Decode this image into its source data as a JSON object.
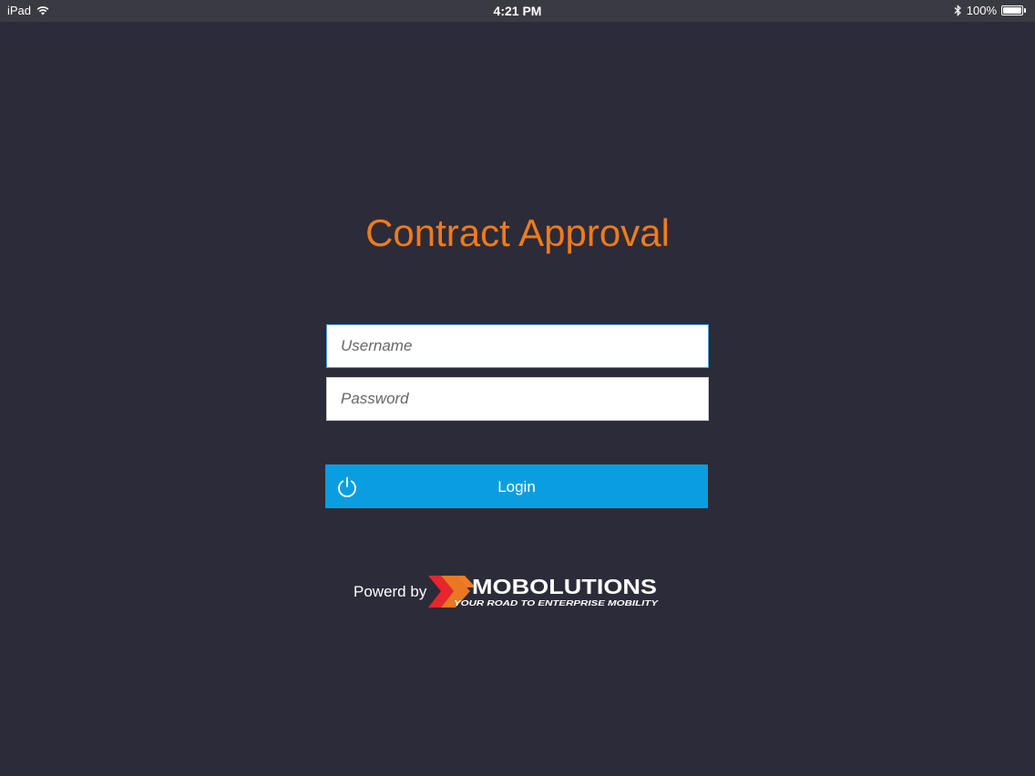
{
  "status_bar": {
    "device": "iPad",
    "time": "4:21 PM",
    "battery": "100%",
    "battery_level": 1.0,
    "icons": [
      "wifi-icon",
      "bluetooth-icon",
      "battery-icon"
    ]
  },
  "app": {
    "title": "Contract Approval"
  },
  "login_form": {
    "username_placeholder": "Username",
    "password_placeholder": "Password",
    "login_label": "Login",
    "login_icon": "power-icon"
  },
  "footer": {
    "powered_by": "Powerd by",
    "logo_name": "MOBOLUTIONS",
    "logo_tagline": "YOUR ROAD TO ENTERPRISE MOBILITY"
  },
  "colors": {
    "background": "#2c2b39",
    "title": "#f07b1a",
    "button": "#0a9ee0",
    "logo_red": "#e8252d",
    "logo_orange": "#f47b20"
  }
}
